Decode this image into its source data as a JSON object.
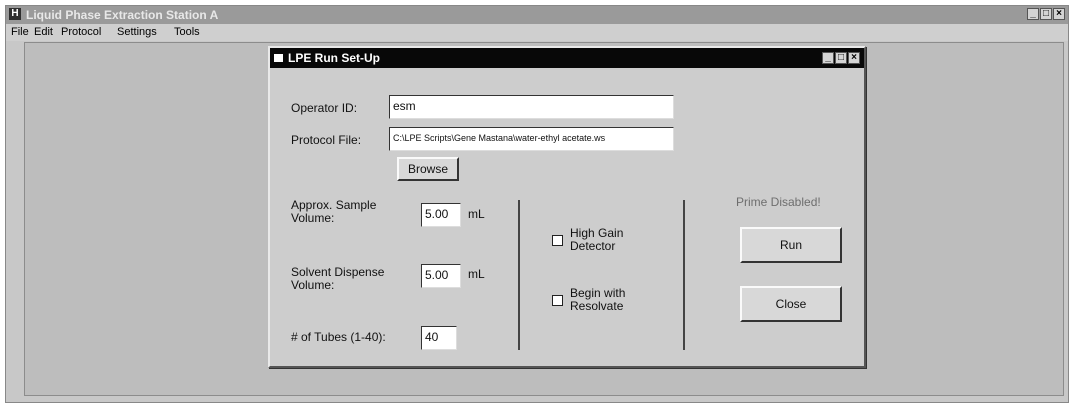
{
  "app": {
    "title": "Liquid Phase Extraction Station A"
  },
  "menu": [
    "File",
    "Edit",
    "Protocol",
    "Settings",
    "Tools"
  ],
  "dialog": {
    "title": "LPE Run Set-Up",
    "operator_label": "Operator ID:",
    "operator_value": "esm",
    "protocol_label": "Protocol File:",
    "protocol_value": "C:\\LPE Scripts\\Gene Mastana\\water-ethyl acetate.ws",
    "browse_label": "Browse",
    "sample_label": "Approx. Sample Volume:",
    "sample_value": "5.00",
    "sample_unit": "mL",
    "solvent_label": "Solvent Dispense Volume:",
    "solvent_value": "5.00",
    "solvent_unit": "mL",
    "tubes_label": "# of Tubes (1-40):",
    "tubes_value": "40",
    "high_gain_label": "High Gain Detector",
    "resolvate_label": "Begin with Resolvate",
    "prime_status": "Prime Disabled!",
    "run_label": "Run",
    "close_label": "Close"
  },
  "icons": {
    "app": "app-icon",
    "dialog": "dialog-icon",
    "minimize": "minimize-icon",
    "maximize": "maximize-icon",
    "close": "close-icon"
  }
}
